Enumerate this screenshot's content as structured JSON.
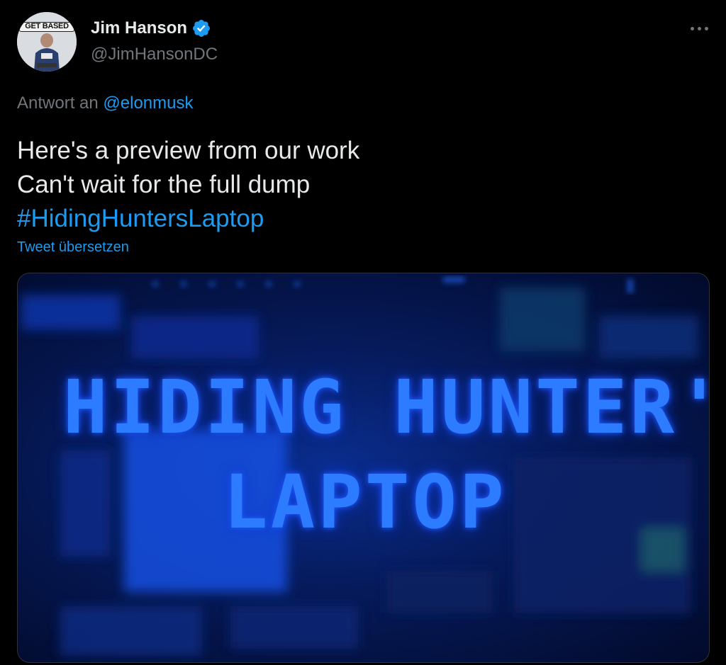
{
  "author": {
    "avatar_badge": "GET BASED",
    "display_name": "Jim Hanson",
    "handle": "@JimHansonDC",
    "verified": true
  },
  "reply": {
    "prefix": "Antwort an",
    "mention": "@elonmusk"
  },
  "tweet": {
    "line1": "Here's a preview from our work",
    "line2": "Can't wait for the full dump",
    "hashtag": "#HidingHuntersLaptop",
    "translate_label": "Tweet übersetzen"
  },
  "media": {
    "title_line1": "HIDING HUNTER'S",
    "title_line2": "LAPTOP"
  },
  "icons": {
    "verified": "verified-badge-icon",
    "more": "more-options-icon"
  },
  "colors": {
    "background": "#000000",
    "text_primary": "#e7e9ea",
    "text_secondary": "#71767b",
    "accent": "#1d9bf0",
    "media_glow": "#2d7bff"
  }
}
